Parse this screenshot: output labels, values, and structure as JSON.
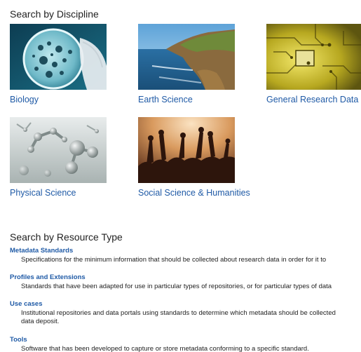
{
  "discipline": {
    "heading": "Search by Discipline",
    "tiles": [
      {
        "label": "Biology",
        "image": "petri-dish-image"
      },
      {
        "label": "Earth Science",
        "image": "coastline-image"
      },
      {
        "label": "General Research Data",
        "image": "circuit-board-image"
      },
      {
        "label": "Physical Science",
        "image": "molecules-image"
      },
      {
        "label": "Social Science & Humanities",
        "image": "crowd-image"
      }
    ]
  },
  "resource_type": {
    "heading": "Search by Resource Type",
    "items": [
      {
        "title": "Metadata Standards",
        "desc_lines": [
          "Specifications for the minimum information that should be collected about research data in order for it to"
        ]
      },
      {
        "title": "Profiles and Extensions",
        "desc_lines": [
          "Standards that have been adapted for use in particular types of repositories, or for particular types of data"
        ]
      },
      {
        "title": "Use cases",
        "desc_lines": [
          "Institutional repositories and data portals using standards to determine which metadata should be collected",
          "data deposit."
        ]
      },
      {
        "title": "Tools",
        "desc_lines": [
          "Software that has been developed to capture or store metadata conforming to a specific standard."
        ]
      }
    ]
  }
}
